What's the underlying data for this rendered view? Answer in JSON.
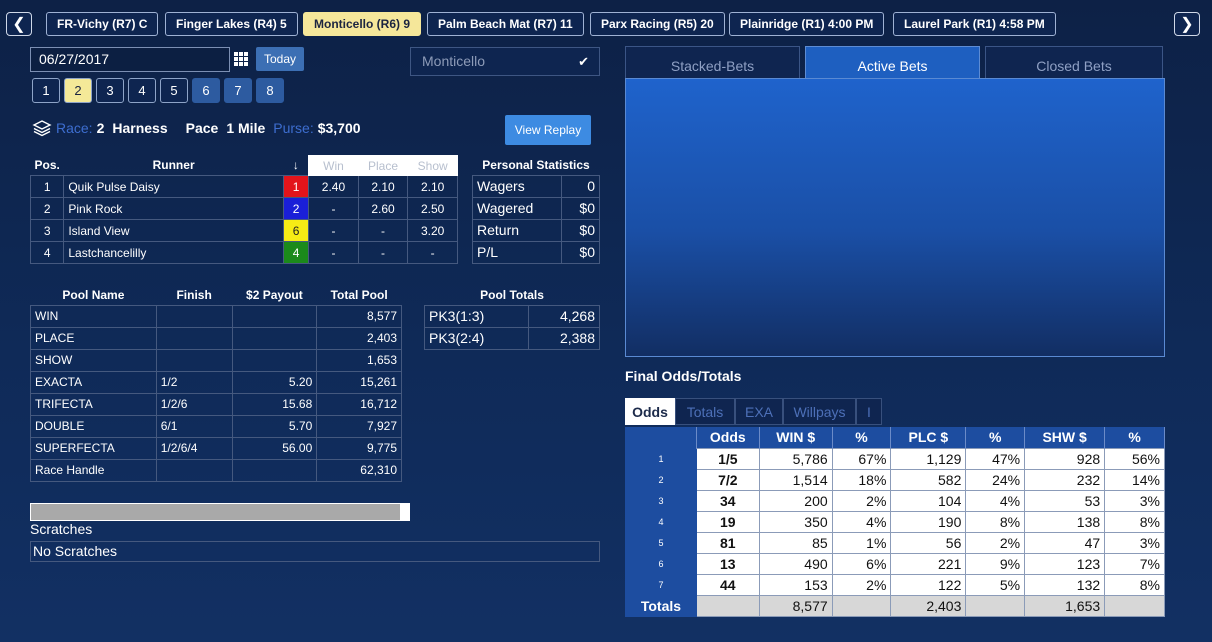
{
  "nav": {
    "prev_icon": "chevron-left-icon",
    "next_icon": "chevron-right-icon"
  },
  "tracks": [
    {
      "label": "FR-Vichy (R7) C",
      "active": false
    },
    {
      "label": "Finger Lakes (R4) 5",
      "active": false
    },
    {
      "label": "Monticello (R6) 9",
      "active": true
    },
    {
      "label": "Palm Beach Mat (R7) 11",
      "active": false
    },
    {
      "label": "Parx Racing (R5) 20",
      "active": false
    },
    {
      "label": "Plainridge (R1)  4:00 PM",
      "active": false
    },
    {
      "label": "Laurel Park (R1)  4:58 PM",
      "active": false
    }
  ],
  "date": {
    "value": "06/27/2017",
    "today_label": "Today"
  },
  "track_select": {
    "value": "Monticello"
  },
  "races": [
    "1",
    "2",
    "3",
    "4",
    "5",
    "6",
    "7",
    "8"
  ],
  "selected_race": "2",
  "race_info": {
    "race_label": "Race:",
    "race_value": "2",
    "breed": "Harness",
    "gait": "Pace",
    "distance": "1 Mile",
    "purse_label": "Purse:",
    "purse_value": "$3,700"
  },
  "replay_label": "View Replay",
  "runners_table": {
    "headers": {
      "pos": "Pos.",
      "runner": "Runner",
      "win": "Win",
      "place": "Place",
      "show": "Show"
    },
    "rows": [
      {
        "pos": "1",
        "name": "Quik Pulse Daisy",
        "saddle": "1",
        "saddle_color": "#e3141b",
        "win": "2.40",
        "place": "2.10",
        "show": "2.10"
      },
      {
        "pos": "2",
        "name": "Pink Rock",
        "saddle": "2",
        "saddle_color": "#1a1fd8",
        "win": "-",
        "place": "2.60",
        "show": "2.50"
      },
      {
        "pos": "3",
        "name": "Island View",
        "saddle": "6",
        "saddle_color": "#f6ec15",
        "win": "-",
        "place": "-",
        "show": "3.20"
      },
      {
        "pos": "4",
        "name": "Lastchancelilly",
        "saddle": "4",
        "saddle_color": "#1b8a1b",
        "win": "-",
        "place": "-",
        "show": "-"
      }
    ]
  },
  "personal_stats": {
    "title": "Personal Statistics",
    "rows": [
      {
        "label": "Wagers",
        "value": "0"
      },
      {
        "label": "Wagered",
        "value": "$0"
      },
      {
        "label": "Return",
        "value": "$0"
      },
      {
        "label": "P/L",
        "value": "$0"
      }
    ]
  },
  "pools": {
    "headers": {
      "name": "Pool Name",
      "finish": "Finish",
      "payout": "$2 Payout",
      "total": "Total Pool"
    },
    "rows": [
      {
        "name": "WIN",
        "finish": "",
        "payout": "",
        "total": "8,577"
      },
      {
        "name": "PLACE",
        "finish": "",
        "payout": "",
        "total": "2,403"
      },
      {
        "name": "SHOW",
        "finish": "",
        "payout": "",
        "total": "1,653"
      },
      {
        "name": "EXACTA",
        "finish": "1/2",
        "payout": "5.20",
        "total": "15,261"
      },
      {
        "name": "TRIFECTA",
        "finish": "1/2/6",
        "payout": "15.68",
        "total": "16,712"
      },
      {
        "name": "DOUBLE",
        "finish": "6/1",
        "payout": "5.70",
        "total": "7,927"
      },
      {
        "name": "SUPERFECTA",
        "finish": "1/2/6/4",
        "payout": "56.00",
        "total": "9,775"
      },
      {
        "name": "Race Handle",
        "finish": "",
        "payout": "",
        "total": "62,310"
      }
    ]
  },
  "pool_totals": {
    "title": "Pool Totals",
    "rows": [
      {
        "name": "PK3(1:3)",
        "value": "4,268"
      },
      {
        "name": "PK3(2:4)",
        "value": "2,388"
      }
    ]
  },
  "scratches": {
    "label": "Scratches",
    "value": "No Scratches"
  },
  "bets_tabs": [
    {
      "label": "Stacked-Bets",
      "active": false
    },
    {
      "label": "Active Bets",
      "active": true
    },
    {
      "label": "Closed Bets",
      "active": false
    }
  ],
  "final_odds": {
    "title": "Final Odds/Totals",
    "tabs": [
      {
        "label": "Odds",
        "active": true
      },
      {
        "label": "Totals",
        "active": false
      },
      {
        "label": "EXA",
        "active": false
      },
      {
        "label": "Willpays",
        "active": false
      },
      {
        "label": "I",
        "active": false
      }
    ],
    "headers": [
      "",
      "Odds",
      "WIN $",
      "%",
      "PLC $",
      "%",
      "SHW $",
      "%"
    ],
    "rows": [
      {
        "post": "1",
        "odds": "1/5",
        "win": "5,786",
        "win_pct": "67%",
        "plc": "1,129",
        "plc_pct": "47%",
        "shw": "928",
        "shw_pct": "56%"
      },
      {
        "post": "2",
        "odds": "7/2",
        "win": "1,514",
        "win_pct": "18%",
        "plc": "582",
        "plc_pct": "24%",
        "shw": "232",
        "shw_pct": "14%"
      },
      {
        "post": "3",
        "odds": "34",
        "win": "200",
        "win_pct": "2%",
        "plc": "104",
        "plc_pct": "4%",
        "shw": "53",
        "shw_pct": "3%"
      },
      {
        "post": "4",
        "odds": "19",
        "win": "350",
        "win_pct": "4%",
        "plc": "190",
        "plc_pct": "8%",
        "shw": "138",
        "shw_pct": "8%"
      },
      {
        "post": "5",
        "odds": "81",
        "win": "85",
        "win_pct": "1%",
        "plc": "56",
        "plc_pct": "2%",
        "shw": "47",
        "shw_pct": "3%"
      },
      {
        "post": "6",
        "odds": "13",
        "win": "490",
        "win_pct": "6%",
        "plc": "221",
        "plc_pct": "9%",
        "shw": "123",
        "shw_pct": "7%"
      },
      {
        "post": "7",
        "odds": "44",
        "win": "153",
        "win_pct": "2%",
        "plc": "122",
        "plc_pct": "5%",
        "shw": "132",
        "shw_pct": "8%"
      }
    ],
    "totals": {
      "label": "Totals",
      "win": "8,577",
      "plc": "2,403",
      "shw": "1,653"
    }
  }
}
